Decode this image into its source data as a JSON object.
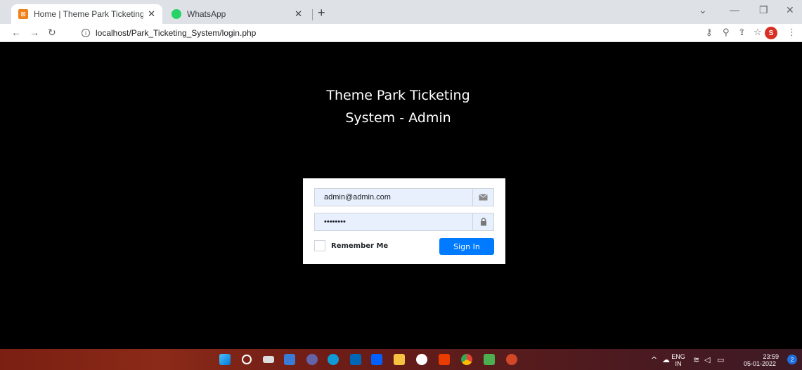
{
  "browser": {
    "tabs": [
      {
        "title": "Home | Theme Park Ticketing Sys",
        "icon": "xampp-icon",
        "icon_color": "#f0801a"
      },
      {
        "title": "WhatsApp",
        "icon": "whatsapp-icon",
        "icon_color": "#25d366"
      }
    ],
    "tab_close": "✕",
    "new_tab": "+",
    "address": "localhost/Park_Ticketing_System/login.php",
    "profile_initial": "S"
  },
  "login": {
    "title_line1": "Theme Park Ticketing",
    "title_line2": "System - Admin",
    "email_value": "admin@admin.com",
    "password_value": "••••••••",
    "remember_label": "Remember Me",
    "signin_label": "Sign In",
    "accent_color": "#007bff"
  },
  "taskbar": {
    "lang_line1": "ENG",
    "lang_line2": "IN",
    "time": "23:59",
    "date": "05-01-2022",
    "notification_count": "2"
  }
}
